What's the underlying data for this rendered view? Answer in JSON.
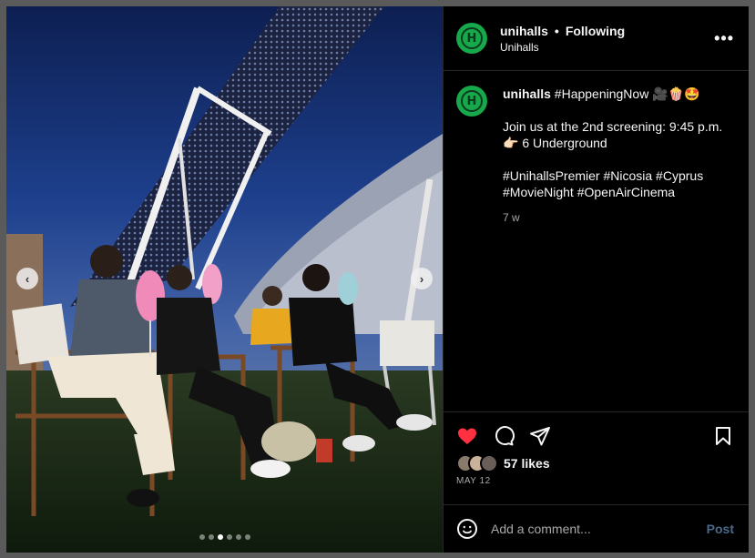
{
  "post": {
    "username": "unihalls",
    "separator": "•",
    "follow_status": "Following",
    "subtitle": "Unihalls",
    "more_label": "•••",
    "avatar_letter": "H",
    "avatar_color": "#17a84b"
  },
  "caption": {
    "username": "unihalls",
    "headline": "#HappeningNow 🎥🍿🤩",
    "paragraph1": "Join us at the 2nd screening: 9:45 p.m. 👉🏻 6 Underground",
    "paragraph2": "#UnihallsPremier #Nicosia #Cyprus #MovieNight #OpenAirCinema",
    "time_ago": "7 w"
  },
  "media": {
    "prev_label": "‹",
    "next_label": "›",
    "slide_count": 6,
    "active_slide": 3
  },
  "actions": {
    "like_icon": "heart-filled-icon",
    "comment_icon": "comment-bubble-icon",
    "share_icon": "paper-plane-icon",
    "save_icon": "bookmark-icon",
    "like_color": "#ff3040"
  },
  "likes": {
    "text": "57 likes",
    "date": "MAY 12"
  },
  "comment_box": {
    "placeholder": "Add a comment...",
    "post_label": "Post"
  }
}
